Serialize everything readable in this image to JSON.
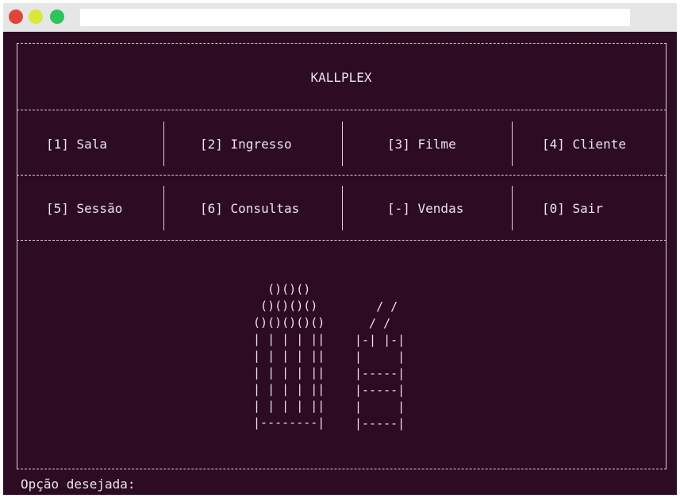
{
  "app": {
    "title": "KALLPLEX"
  },
  "menu": {
    "row1": [
      {
        "key": "[1]",
        "label": "Sala",
        "text": "[1] Sala"
      },
      {
        "key": "[2]",
        "label": "Ingresso",
        "text": "[2] Ingresso"
      },
      {
        "key": "[3]",
        "label": "Filme",
        "text": "[3] Filme"
      },
      {
        "key": "[4]",
        "label": "Cliente",
        "text": "[4] Cliente"
      }
    ],
    "row2": [
      {
        "key": "[5]",
        "label": "Sessão",
        "text": "[5] Sessão"
      },
      {
        "key": "[6]",
        "label": "Consultas",
        "text": "[6] Consultas"
      },
      {
        "key": "[-]",
        "label": "Vendas",
        "text": "[-] Vendas"
      },
      {
        "key": "[0]",
        "label": "Sair",
        "text": "[0] Sair"
      }
    ]
  },
  "art": {
    "popcorn": "   ()()()\n  ()()()()\n ()()()()()\n | | | | ||\n | | | | ||\n | | | | ||\n | | | | ||\n | | | | ||\n |--------|",
    "drink": "   / /\n  / /\n|-| |-|\n|     |\n|-----|\n|-----|\n|     |\n|-----|"
  },
  "prompt": {
    "text": "Opção desejada:"
  }
}
